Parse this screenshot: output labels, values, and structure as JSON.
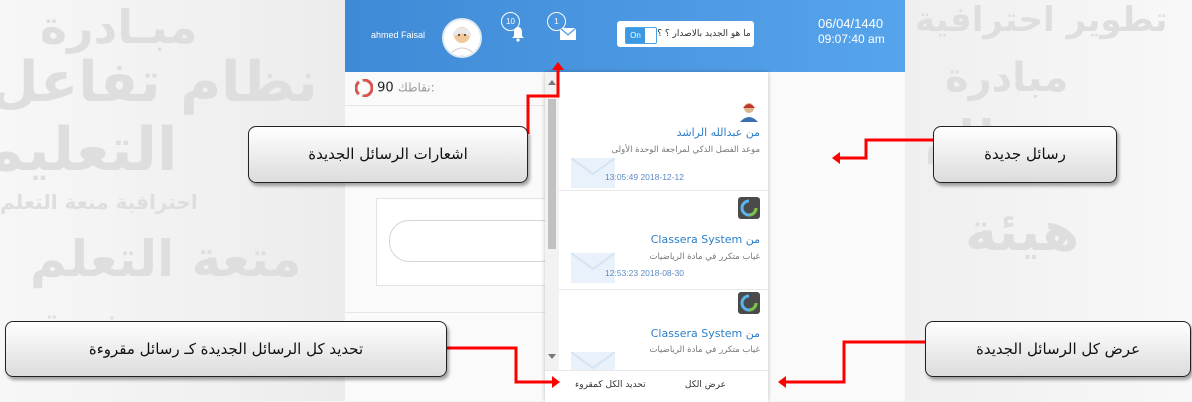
{
  "user": {
    "name": "ahmed Faisal"
  },
  "header": {
    "notifications_count": "10",
    "messages_count": "1",
    "whats_new_label": "ما هو الجديد بالاصدار ؟ ؟",
    "toggle_label": "On",
    "date": "06/04/1440",
    "time": "09:07:40 am"
  },
  "points": {
    "label": "نقاطك:",
    "value": "90"
  },
  "messages_dropdown": {
    "items": [
      {
        "from": "من عبدالله الراشد",
        "subject": "موعد الفصل الذكي لمراجعة الوحدة الأولى",
        "timestamp": "13:05:49 2018-12-12",
        "avatar_icon": "person-avatar-icon"
      },
      {
        "from": "Classera System من",
        "subject": "غياب متكرر في مادة الرياضيات",
        "timestamp": "12:53:23 2018-08-30",
        "avatar_icon": "classera-logo-icon"
      },
      {
        "from": "Classera System من",
        "subject": "غياب متكرر في مادة الرياضيات",
        "timestamp": "",
        "avatar_icon": "classera-logo-icon"
      }
    ],
    "view_all_label": "عرض الكل",
    "mark_all_read_label": "تحديد الكل كمقروء"
  },
  "callouts": {
    "new_message_notifications": "اشعارات الرسائل الجديدة",
    "new_messages": "رسائل جديدة",
    "mark_all_new_as_read": "تحديد كل الرسائل الجديدة كـ رسائل مقروءة",
    "view_all_new_messages": "عرض كل الرسائل الجديدة"
  },
  "colors": {
    "header_blue": "#4a97e2",
    "link_blue": "#2d7ec8",
    "arrow_red": "#ff0000"
  }
}
